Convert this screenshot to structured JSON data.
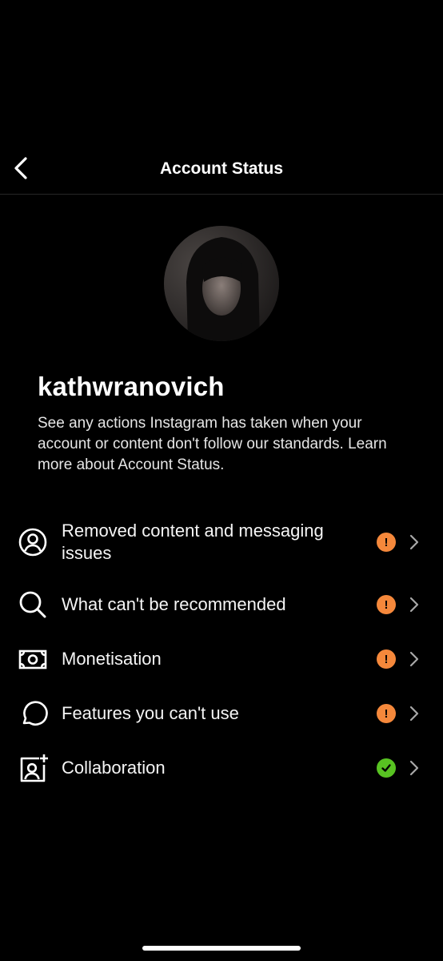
{
  "header": {
    "title": "Account Status"
  },
  "profile": {
    "username": "kathwranovich",
    "description": "See any actions Instagram has taken when your account or content don't follow our standards.",
    "learn_more": "Learn more about Account Status."
  },
  "items": [
    {
      "label": "Removed content and messaging issues",
      "icon": "person-circle-icon",
      "status": "warning"
    },
    {
      "label": "What can't be recommended",
      "icon": "search-icon",
      "status": "warning"
    },
    {
      "label": "Monetisation",
      "icon": "money-icon",
      "status": "warning"
    },
    {
      "label": "Features you can't use",
      "icon": "chat-bubble-icon",
      "status": "warning"
    },
    {
      "label": "Collaboration",
      "icon": "add-collaborator-icon",
      "status": "ok"
    }
  ],
  "colors": {
    "warning": "#f5883b",
    "ok": "#58c322",
    "background": "#000000",
    "text": "#ffffff"
  }
}
